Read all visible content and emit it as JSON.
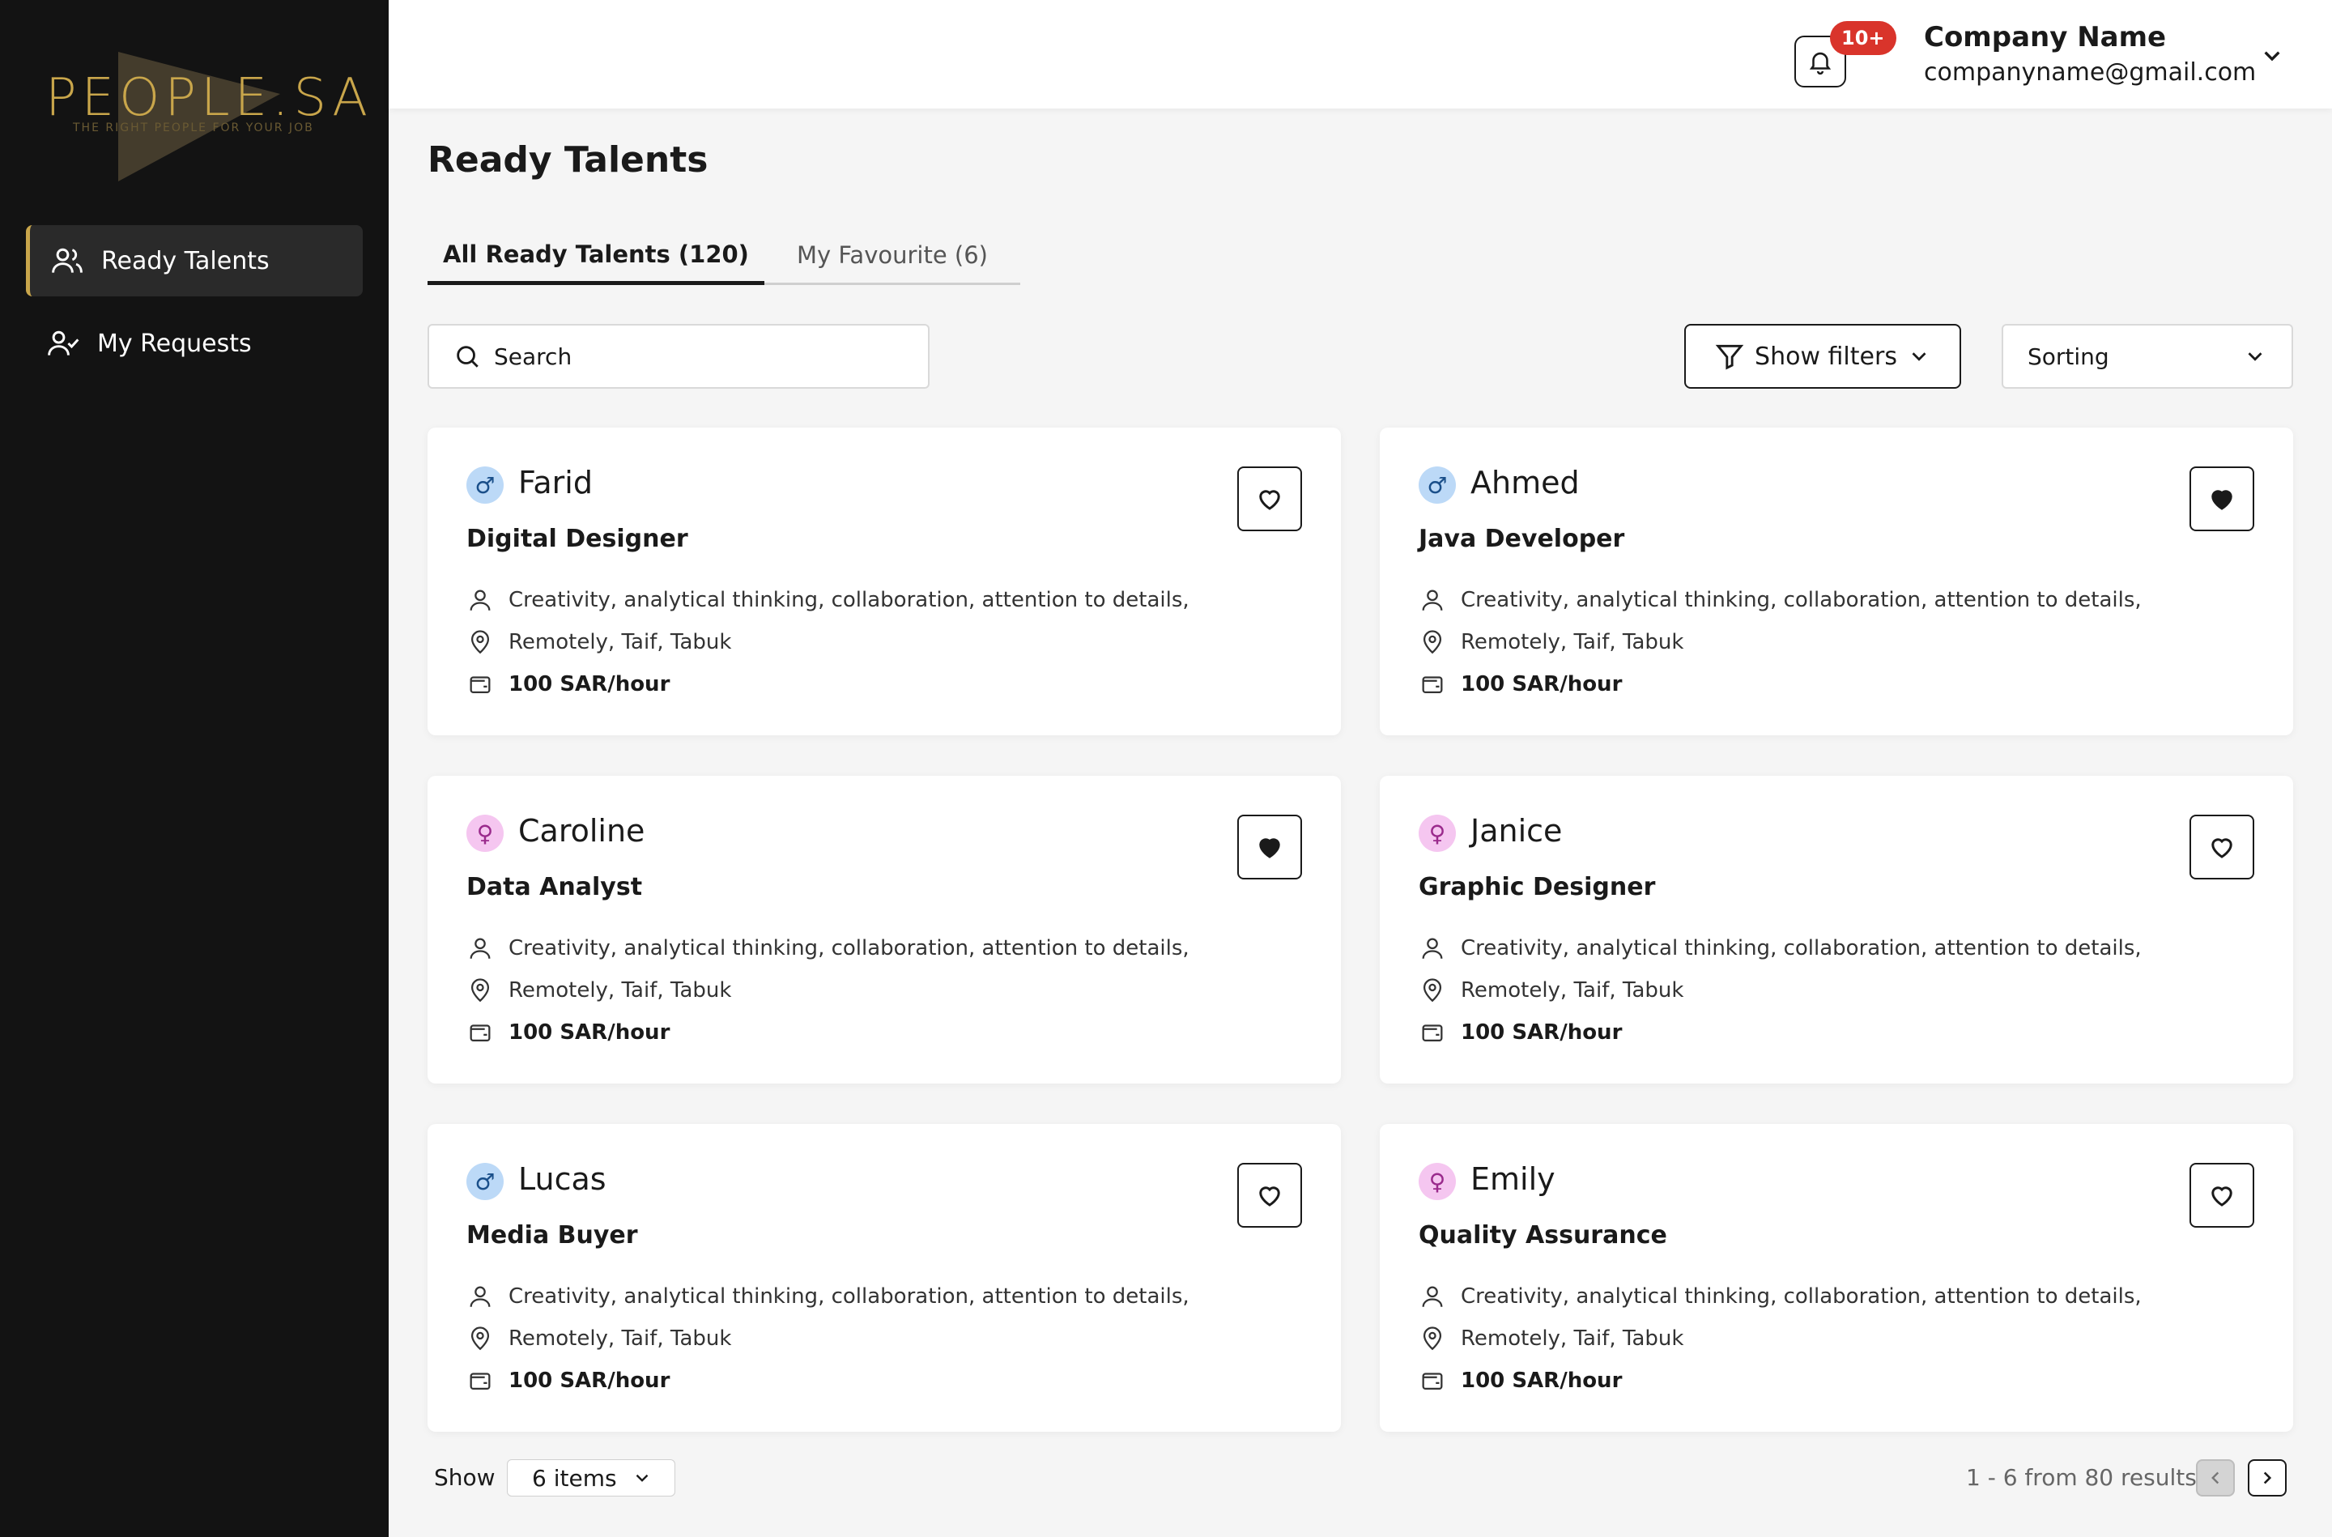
{
  "brand": {
    "name": "PEOPLE.SA",
    "tagline": "THE RIGHT PEOPLE FOR YOUR JOB"
  },
  "sidebar": {
    "items": [
      {
        "label": "Ready Talents",
        "icon": "users-icon",
        "active": true
      },
      {
        "label": "My Requests",
        "icon": "user-check-icon",
        "active": false
      }
    ]
  },
  "header": {
    "notifications_badge": "10+",
    "company_name": "Company Name",
    "company_email": "companyname@gmail.com"
  },
  "main": {
    "title": "Ready Talents",
    "tabs": [
      {
        "label": "All Ready Talents (120)",
        "active": true
      },
      {
        "label": "My Favourite (6)",
        "active": false
      }
    ],
    "search_placeholder": "Search",
    "filters_label": "Show filters",
    "sorting_label": "Sorting"
  },
  "talents": [
    {
      "name": "Farid",
      "gender": "male",
      "role": "Digital Designer",
      "skills": "Creativity, analytical thinking, collaboration, attention to details,",
      "location": "Remotely, Taif, Tabuk",
      "rate": "100 SAR/hour",
      "favourite": false
    },
    {
      "name": "Ahmed",
      "gender": "male",
      "role": "Java Developer",
      "skills": "Creativity, analytical thinking, collaboration, attention to details,",
      "location": "Remotely, Taif, Tabuk",
      "rate": "100 SAR/hour",
      "favourite": true
    },
    {
      "name": "Caroline",
      "gender": "female",
      "role": "Data Analyst",
      "skills": "Creativity, analytical thinking, collaboration, attention to details,",
      "location": "Remotely, Taif, Tabuk",
      "rate": "100 SAR/hour",
      "favourite": true
    },
    {
      "name": "Janice",
      "gender": "female",
      "role": "Graphic Designer",
      "skills": "Creativity, analytical thinking, collaboration, attention to details,",
      "location": "Remotely, Taif, Tabuk",
      "rate": "100 SAR/hour",
      "favourite": false
    },
    {
      "name": "Lucas",
      "gender": "male",
      "role": "Media Buyer",
      "skills": "Creativity, analytical thinking, collaboration, attention to details,",
      "location": "Remotely, Taif, Tabuk",
      "rate": "100 SAR/hour",
      "favourite": false
    },
    {
      "name": "Emily",
      "gender": "female",
      "role": "Quality Assurance",
      "skills": "Creativity, analytical thinking, collaboration, attention to details,",
      "location": "Remotely, Taif, Tabuk",
      "rate": "100 SAR/hour",
      "favourite": false
    }
  ],
  "pagination": {
    "show_label": "Show",
    "page_size": "6 items",
    "results_text": "1 - 6 from 80 results"
  },
  "colors": {
    "accent": "#c9a64b",
    "sidebar_bg": "#131313",
    "badge": "#d9342b",
    "male": "#bcd9f7",
    "female": "#f5c6f0"
  }
}
